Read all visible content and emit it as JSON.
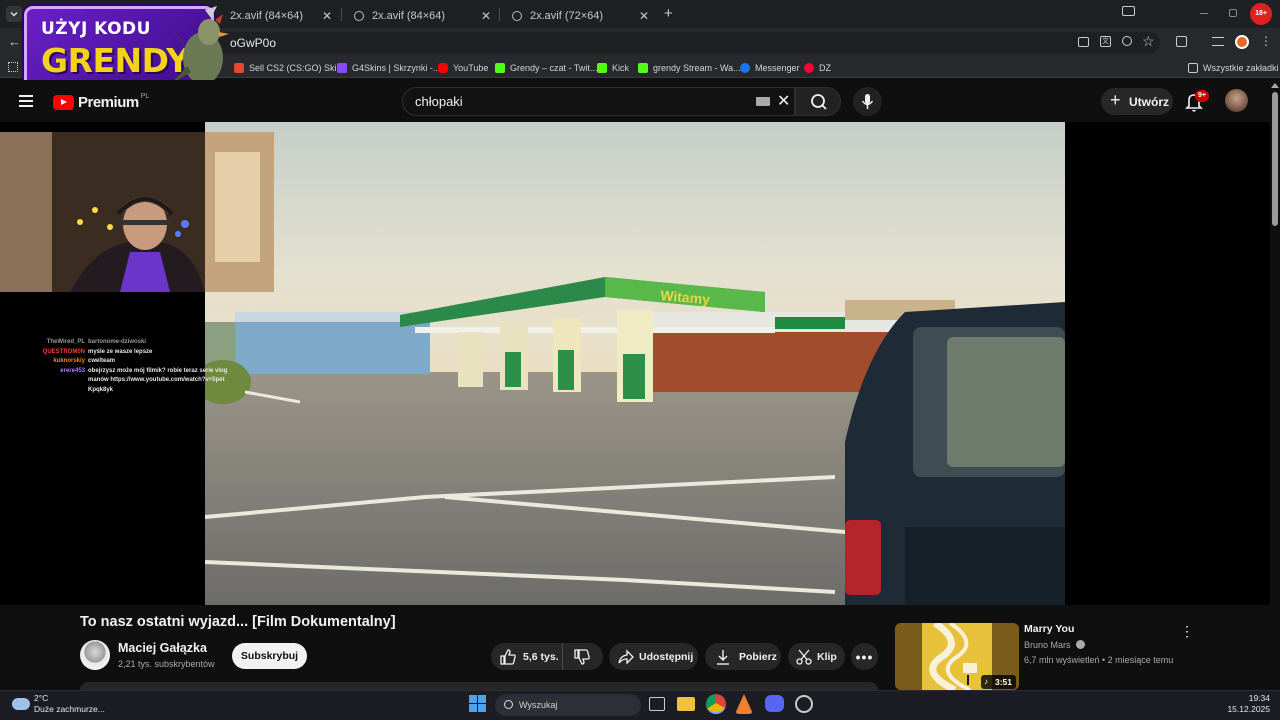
{
  "browser": {
    "tabs": [
      {
        "label": "2x.avif (84×64)",
        "partial_label": "2x.avif (84×64)"
      },
      {
        "label": "2x.avif (84×64)"
      },
      {
        "label": "2x.avif (72×64)"
      }
    ],
    "url_fragment": "oGwP0o",
    "profile_badge": "18+",
    "bookmarks": [
      {
        "label": "Sell CS2 (CS:GO) Ski...",
        "color": "#e34a2a"
      },
      {
        "label": "G4Skins | Skrzynki -...",
        "color": "#8a4bff"
      },
      {
        "label": "YouTube",
        "color": "#ff0000"
      },
      {
        "label": "Grendy – czat - Twit...",
        "color": "#53fc18"
      },
      {
        "label": "Kick",
        "color": "#53fc18"
      },
      {
        "label": "grendy Stream - Wa...",
        "color": "#53fc18"
      },
      {
        "label": "Messenger",
        "color": "#1877f2"
      },
      {
        "label": "DZ",
        "color": "#ff0033"
      }
    ],
    "all_bookmarks_label": "Wszystkie zakładki"
  },
  "promo": {
    "line1": "UŻYJ KODU",
    "line2": "GRENDY"
  },
  "youtube": {
    "logo_text": "Premium",
    "logo_country": "PL",
    "search_value": "chłopaki",
    "create_label": "Utwórz",
    "notifications_badge": "9+",
    "accent": "#ff0000"
  },
  "chat": [
    {
      "user": "TheWired_PL",
      "message": "bartonome-dziwoski",
      "color": "#9a9a9a"
    },
    {
      "user": "QUESTROM0N",
      "message": "myśle ze wasze lepsze",
      "color": "#ff3b3b"
    },
    {
      "user": "kuknorskiy",
      "message": "cwelteam",
      "color": "#ff7f1f"
    },
    {
      "user": "erere453",
      "message": "obejrzysz może mój filmik? robie teraz serie vlogmanów https://www.youtube.com/watch?v=5petKpqk8yk",
      "color": "#b37cff"
    }
  ],
  "video": {
    "title": "To nasz ostatni wyjazd... [Film Dokumentalny]",
    "sign_text": "Witamy",
    "channel": "Maciej Gałązka",
    "subscribers": "2,21 tys. subskrybentów",
    "subscribe_label": "Subskrybuj",
    "likes": "5,6 tys.",
    "share_label": "Udostępnij",
    "download_label": "Pobierz",
    "clip_label": "Klip"
  },
  "recommendation": {
    "title": "Marry You",
    "artist": "Bruno Mars",
    "meta": "6,7 mln wyświetleń • 2 miesiące temu",
    "duration": "3:51"
  },
  "taskbar": {
    "weather_temp": "2°C",
    "weather_desc": "Duże zachmurze...",
    "search_placeholder": "Wyszukaj",
    "time": "19:34",
    "date": "15.12.2025"
  }
}
